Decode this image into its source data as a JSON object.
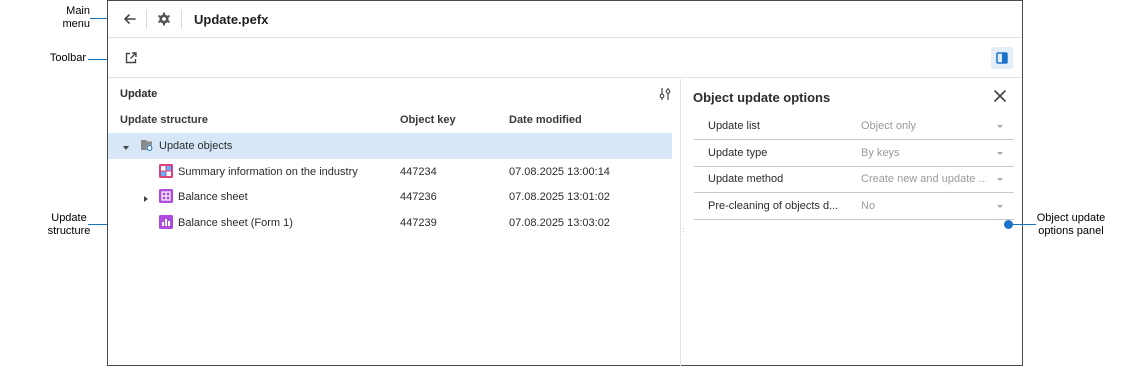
{
  "callouts": {
    "main_menu": "Main menu",
    "main_menu_line1": "Main",
    "main_menu_line2": "menu",
    "toolbar": "Toolbar",
    "update_structure_line1": "Update",
    "update_structure_line2": "structure",
    "options_panel_line1": "Object update",
    "options_panel_line2": "options panel"
  },
  "menubar": {
    "title": "Update.pefx",
    "back_icon": "arrow-left-icon",
    "settings_icon": "gear-icon"
  },
  "toolbar": {
    "export_icon": "external-link-icon",
    "panel_toggle_icon": "side-panel-icon"
  },
  "update_panel": {
    "title": "Update",
    "columns": [
      "Update structure",
      "Object key",
      "Date modified"
    ],
    "rows": [
      {
        "name": "Update objects",
        "key": "",
        "date": "",
        "icon": "folder-update-icon",
        "expanded": true,
        "selected": true
      },
      {
        "name": "Summary information on the industry",
        "key": "447234",
        "date": "07.08.2025 13:00:14",
        "icon": "dashboard-icon"
      },
      {
        "name": "Balance sheet",
        "key": "447236",
        "date": "07.08.2025 13:01:02",
        "icon": "spreadsheet-icon",
        "collapsed": true
      },
      {
        "name": "Balance sheet (Form 1)",
        "key": "447239",
        "date": "07.08.2025 13:03:02",
        "icon": "chart-report-icon"
      }
    ]
  },
  "options_panel": {
    "title": "Object update options",
    "options": [
      {
        "label": "Update list",
        "value": "Object only"
      },
      {
        "label": "Update type",
        "value": "By keys"
      },
      {
        "label": "Update method",
        "value": "Create new and update ..."
      },
      {
        "label": "Pre-cleaning of objects d...",
        "value": "No"
      }
    ]
  },
  "colors": {
    "accent": "#1a73c8",
    "selection": "#d7e7f8"
  }
}
